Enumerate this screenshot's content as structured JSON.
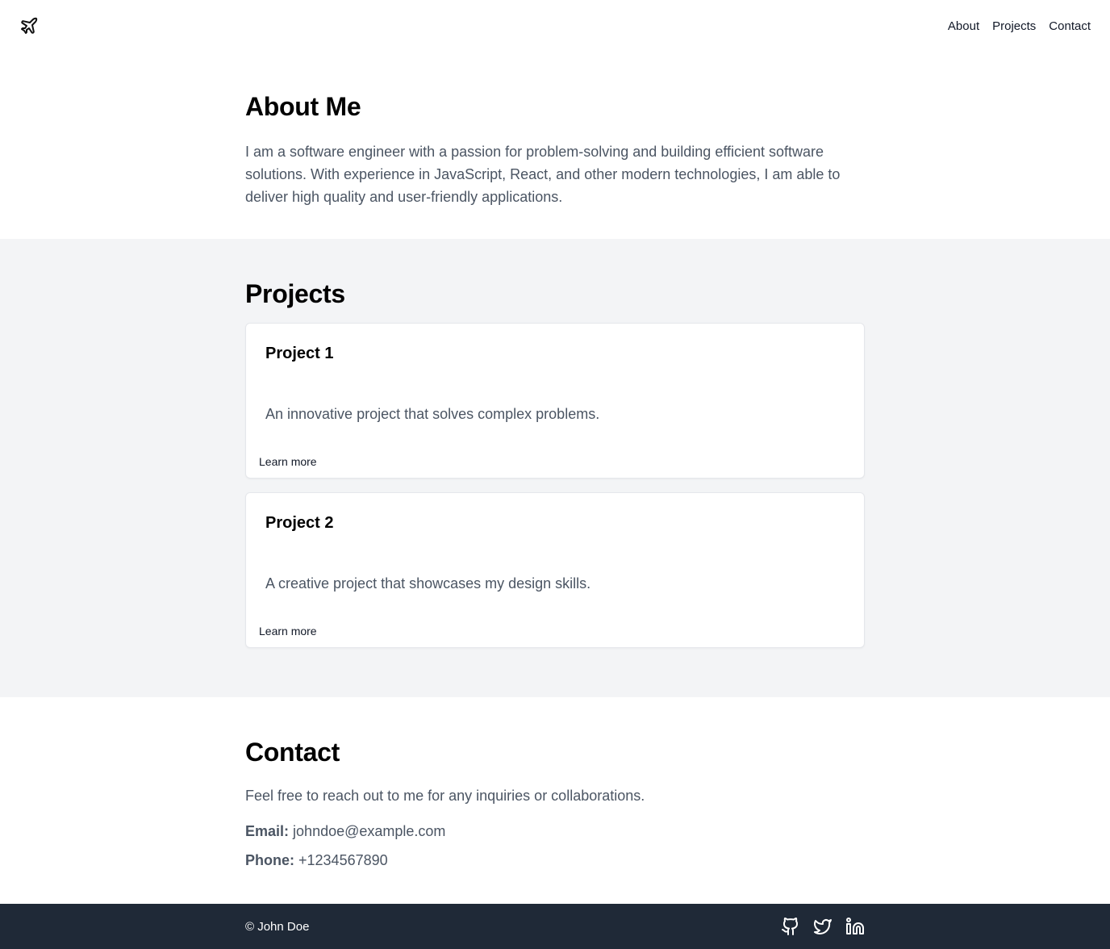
{
  "header": {
    "logo_icon": "plane-icon",
    "nav": [
      {
        "label": "About"
      },
      {
        "label": "Projects"
      },
      {
        "label": "Contact"
      }
    ]
  },
  "about": {
    "title": "About Me",
    "text": "I am a software engineer with a passion for problem-solving and building efficient software solutions. With experience in JavaScript, React, and other modern technologies, I am able to deliver high quality and user-friendly applications."
  },
  "projects": {
    "title": "Projects",
    "items": [
      {
        "title": "Project 1",
        "description": "An innovative project that solves complex problems.",
        "link": "Learn more"
      },
      {
        "title": "Project 2",
        "description": "A creative project that showcases my design skills.",
        "link": "Learn more"
      }
    ]
  },
  "contact": {
    "title": "Contact",
    "lead": "Feel free to reach out to me for any inquiries or collaborations.",
    "email_label": "Email:",
    "email": "johndoe@example.com",
    "phone_label": "Phone:",
    "phone": "+1234567890"
  },
  "footer": {
    "copyright": "© John Doe",
    "social_icons": [
      "github-icon",
      "twitter-icon",
      "linkedin-icon"
    ]
  },
  "colors": {
    "projects_bg": "#f3f4f6",
    "footer_bg": "#1f2937",
    "body_text": "#4b5563"
  }
}
